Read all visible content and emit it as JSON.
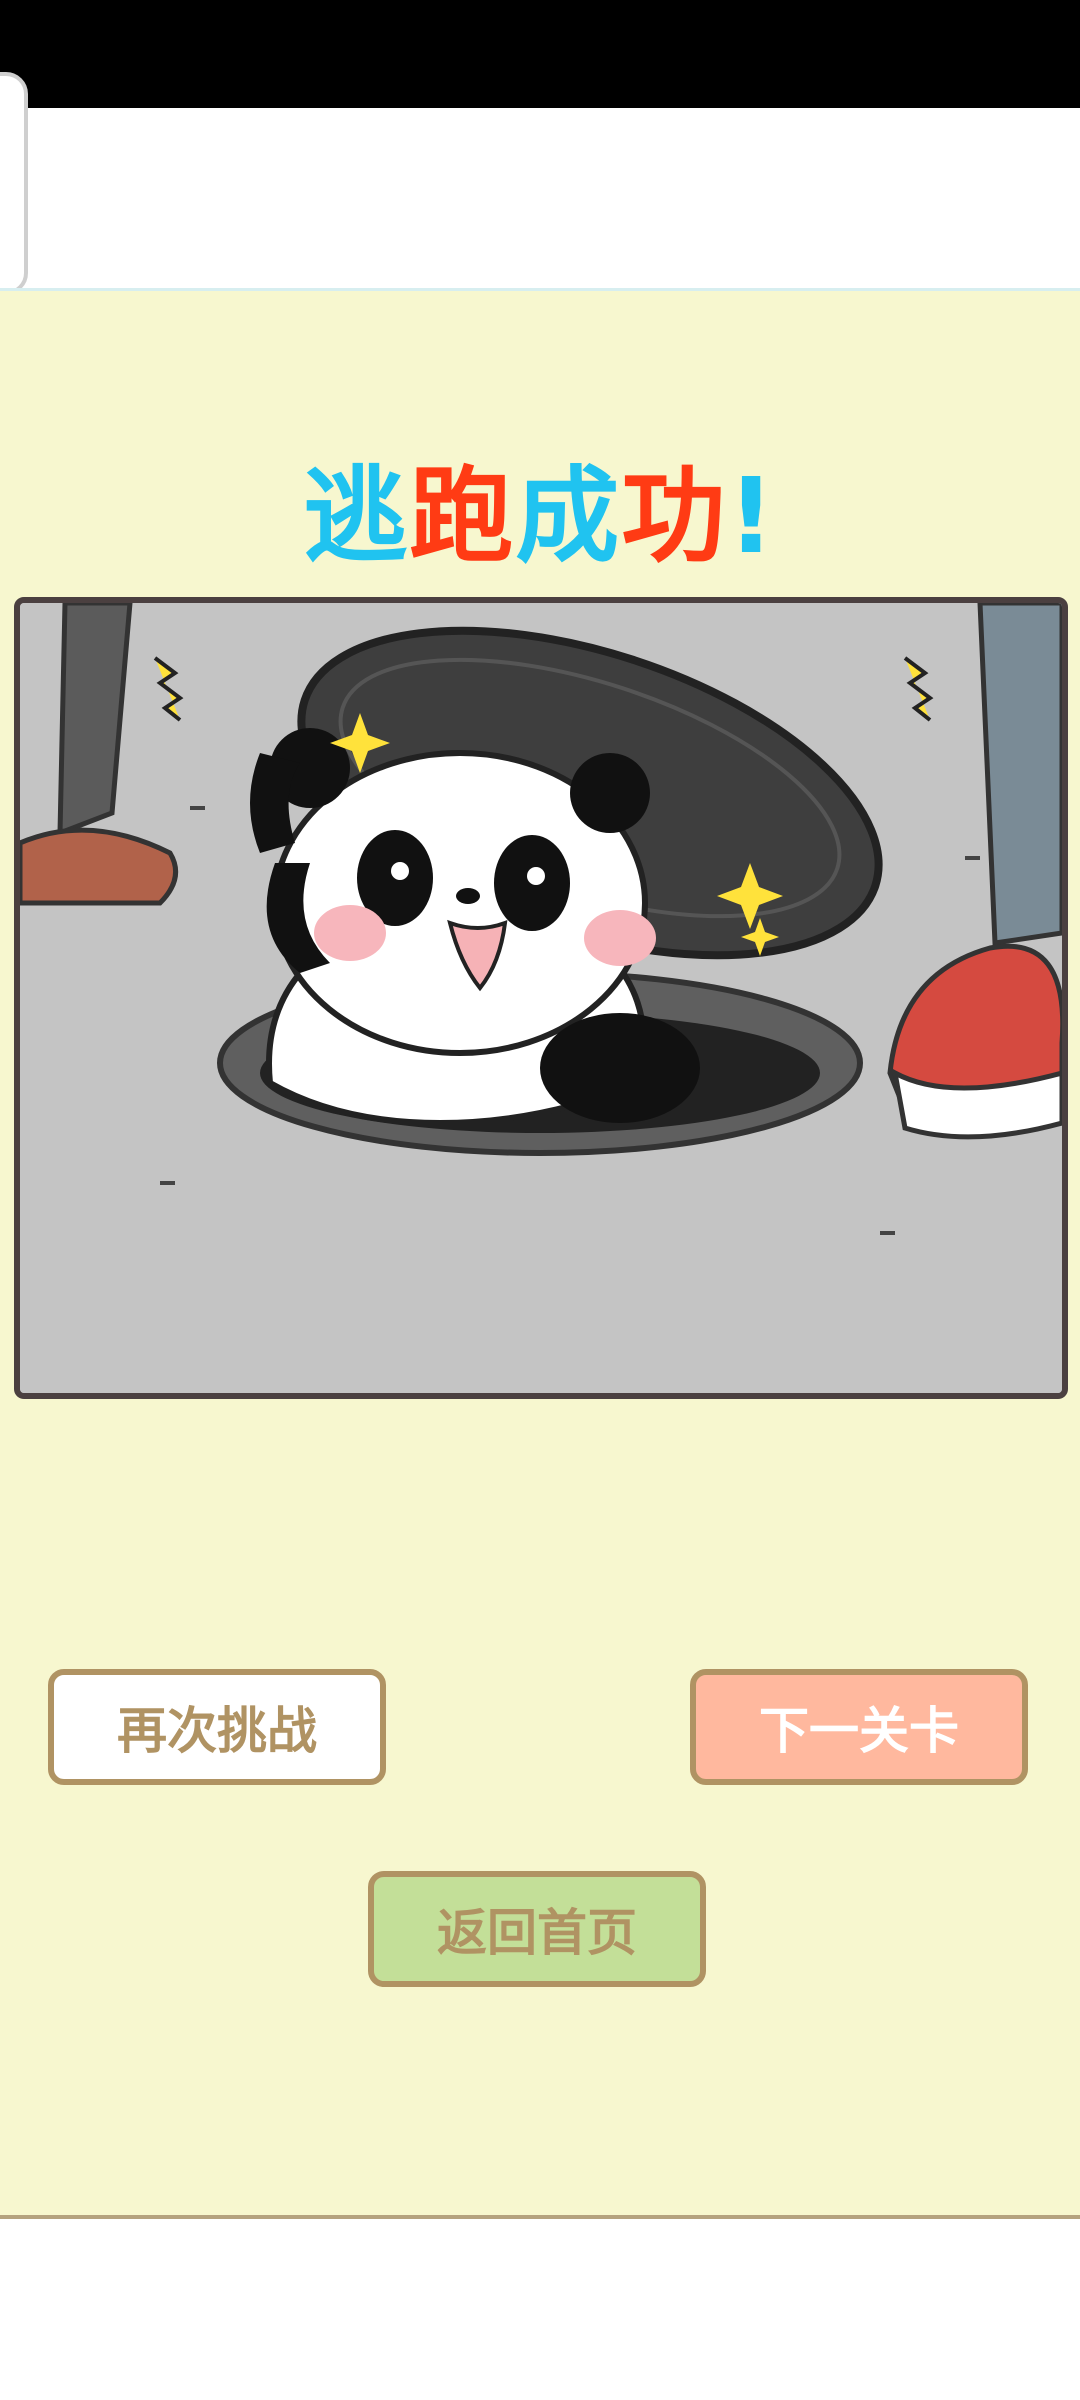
{
  "title": {
    "chars": [
      {
        "text": "逃",
        "color": "#20c3f0"
      },
      {
        "text": "跑",
        "color": "#ff3b14"
      },
      {
        "text": "成",
        "color": "#20c3f0"
      },
      {
        "text": "功",
        "color": "#ff3b14"
      },
      {
        "text": "!",
        "color": "#20c3f0"
      }
    ]
  },
  "buttons": {
    "retry": "再次挑战",
    "next": "下一关卡",
    "home": "返回首页"
  },
  "scene": {
    "description_icon": "panda-in-manhole-illustration"
  }
}
